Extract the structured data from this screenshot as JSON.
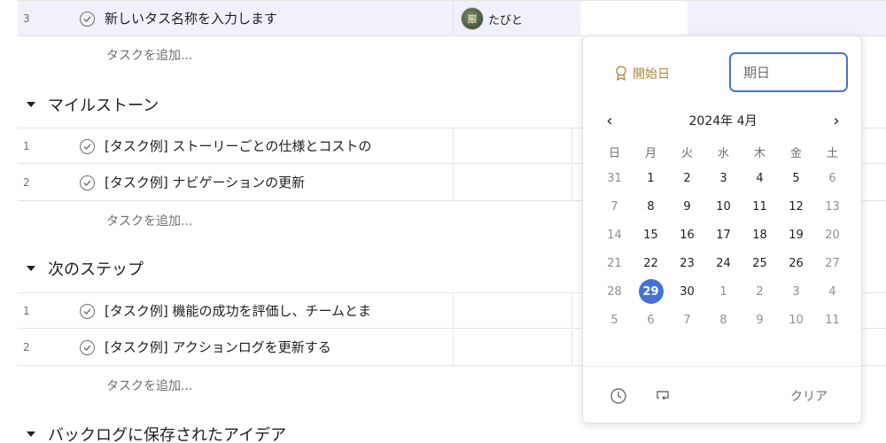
{
  "top_row": {
    "number": "3",
    "name": "新しいタス名称を入力します",
    "assignee_avatar_glyph": "巌",
    "assignee_name": "たびと"
  },
  "add_task_label": "タスクを追加...",
  "sections": [
    {
      "title": "マイルストーン",
      "tasks": [
        {
          "number": "1",
          "name": "[タスク例] ストーリーごとの仕様とコストの"
        },
        {
          "number": "2",
          "name": "[タスク例] ナビゲーションの更新"
        }
      ]
    },
    {
      "title": "次のステップ",
      "tasks": [
        {
          "number": "1",
          "name": "[タスク例] 機能の成功を評価し、チームとま"
        },
        {
          "number": "2",
          "name": "[タスク例] アクションログを更新する"
        }
      ]
    },
    {
      "title": "バックログに保存されたアイデア",
      "tasks": []
    }
  ],
  "date_picker": {
    "start_date_label": "開始日",
    "due_placeholder": "期日",
    "month_label": "2024年 4月",
    "prev_icon": "‹",
    "next_icon": "›",
    "weekdays": [
      "日",
      "月",
      "火",
      "水",
      "木",
      "金",
      "土"
    ],
    "weeks": [
      [
        "31",
        "1",
        "2",
        "3",
        "4",
        "5",
        "6"
      ],
      [
        "7",
        "8",
        "9",
        "10",
        "11",
        "12",
        "13"
      ],
      [
        "14",
        "15",
        "16",
        "17",
        "18",
        "19",
        "20"
      ],
      [
        "21",
        "22",
        "23",
        "24",
        "25",
        "26",
        "27"
      ],
      [
        "28",
        "29",
        "30",
        "1",
        "2",
        "3",
        "4"
      ],
      [
        "5",
        "6",
        "7",
        "8",
        "9",
        "10",
        "11"
      ]
    ],
    "selected_day": "29",
    "clear_label": "クリア",
    "icons": [
      "clock-icon",
      "repeat-icon"
    ],
    "accent_color": "#4573d2",
    "start_color": "#b08438"
  }
}
